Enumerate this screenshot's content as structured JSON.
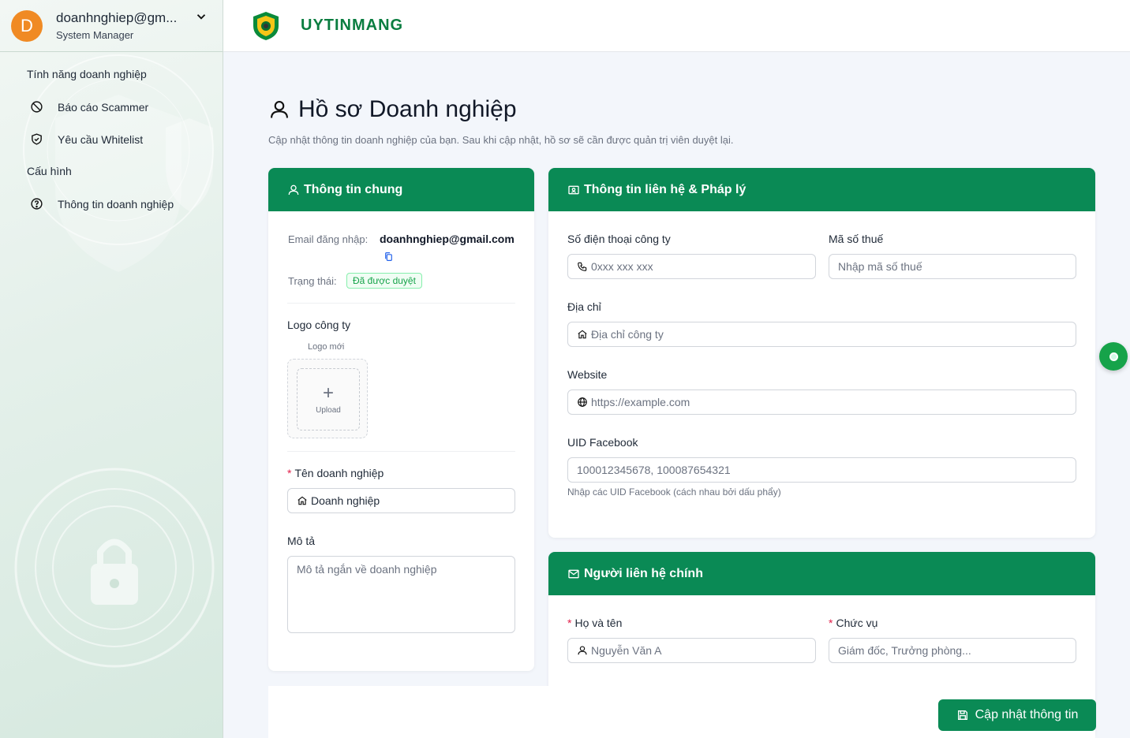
{
  "sidebar": {
    "user": {
      "initial": "D",
      "name": "doanhnghiep@gm...",
      "role": "System Manager"
    },
    "sections": [
      {
        "title": "Tính năng doanh nghiệp",
        "items": [
          {
            "label": "Báo cáo Scammer",
            "icon": "ban-icon"
          },
          {
            "label": "Yêu cầu Whitelist",
            "icon": "shield-check-icon"
          }
        ]
      },
      {
        "title": "Cấu hình",
        "items": [
          {
            "label": "Thông tin doanh nghiệp",
            "icon": "question-circle-icon"
          }
        ]
      }
    ]
  },
  "topbar": {
    "brand": "UYTINMANG"
  },
  "page": {
    "title": "Hồ sơ Doanh nghiệp",
    "subtitle": "Cập nhật thông tin doanh nghiệp của bạn. Sau khi cập nhật, hồ sơ sẽ cần được quản trị viên duyệt lại."
  },
  "general": {
    "header": "Thông tin chung",
    "email_label": "Email đăng nhập:",
    "email_value": "doanhnghiep@gmail.com",
    "status_label": "Trạng thái:",
    "status_value": "Đã được duyệt",
    "logo_label": "Logo công ty",
    "logo_sub": "Logo mới",
    "upload_label": "Upload",
    "name_label": "Tên doanh nghiệp",
    "name_value": "Doanh nghiệp",
    "desc_label": "Mô tả",
    "desc_placeholder": "Mô tả ngắn về doanh nghiệp"
  },
  "contact": {
    "header": "Thông tin liên hệ & Pháp lý",
    "phone_label": "Số điện thoại công ty",
    "phone_placeholder": "0xxx xxx xxx",
    "tax_label": "Mã số thuế",
    "tax_placeholder": "Nhập mã số thuế",
    "address_label": "Địa chỉ",
    "address_placeholder": "Địa chỉ công ty",
    "website_label": "Website",
    "website_placeholder": "https://example.com",
    "uid_label": "UID Facebook",
    "uid_placeholder": "100012345678, 100087654321",
    "uid_help": "Nhập các UID Facebook (cách nhau bởi dấu phẩy)"
  },
  "person": {
    "header": "Người liên hệ chính",
    "fullname_label": "Họ và tên",
    "fullname_placeholder": "Nguyễn Văn A",
    "position_label": "Chức vụ",
    "position_placeholder": "Giám đốc, Trưởng phòng..."
  },
  "actions": {
    "submit": "Cập nhật thông tin"
  },
  "colors": {
    "primary": "#0a8a55",
    "avatar": "#f08a24",
    "brand": "#0a7d40"
  }
}
